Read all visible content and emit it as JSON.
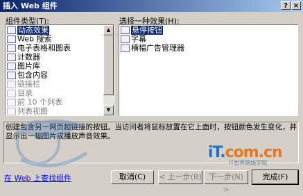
{
  "window": {
    "title": "插入 Web 组件",
    "help_button": "?",
    "close_button": "×"
  },
  "component_type": {
    "label": "组件类型(T):",
    "items": [
      {
        "label": "动态效果",
        "icon": "animation-icon",
        "selected": true,
        "disabled": false
      },
      {
        "label": "Web 搜索",
        "icon": "web-search-icon",
        "selected": false,
        "disabled": false
      },
      {
        "label": "电子表格和图表",
        "icon": "spreadsheet-icon",
        "selected": false,
        "disabled": false
      },
      {
        "label": "计数器",
        "icon": "counter-icon",
        "selected": false,
        "disabled": false
      },
      {
        "label": "图片库",
        "icon": "photo-gallery-icon",
        "selected": false,
        "disabled": false
      },
      {
        "label": "包含内容",
        "icon": "include-content-icon",
        "selected": false,
        "disabled": false
      },
      {
        "label": "链接栏",
        "icon": "link-bar-icon",
        "selected": false,
        "disabled": true
      },
      {
        "label": "目录",
        "icon": "toc-icon",
        "selected": false,
        "disabled": true
      },
      {
        "label": "前 10 个列表",
        "icon": "top-ten-icon",
        "selected": false,
        "disabled": true
      },
      {
        "label": "列表视图",
        "icon": "list-view-icon",
        "selected": false,
        "disabled": true
      }
    ]
  },
  "effect": {
    "label": "选择一种效果(H):",
    "items": [
      {
        "label": "悬停按钮",
        "icon": "hover-button-icon",
        "selected": true
      },
      {
        "label": "字幕",
        "icon": "marquee-icon",
        "selected": false
      },
      {
        "label": "横幅广告管理器",
        "icon": "banner-ad-icon",
        "selected": false
      }
    ]
  },
  "description": "创建包含另一网页超链接的按钮。当访问者将鼠标放置在它上面时，按钮颜色发生变化，并显示出一幅图片或播放声音效果。",
  "watermark_logo": {
    "part1": "iT.",
    "part2": "com.cn",
    "sub": "IT世界网络学院"
  },
  "footer": {
    "link": "在 Web 上查找组件",
    "cancel": "取消(C)",
    "back": "< 上一步(B)",
    "next": "下一步(N) >",
    "finish": "完成(F)"
  },
  "colors": {
    "title_start": "#0a246a",
    "title_end": "#a6caf0",
    "selection": "#0a246a",
    "face": "#d4d0c8"
  }
}
